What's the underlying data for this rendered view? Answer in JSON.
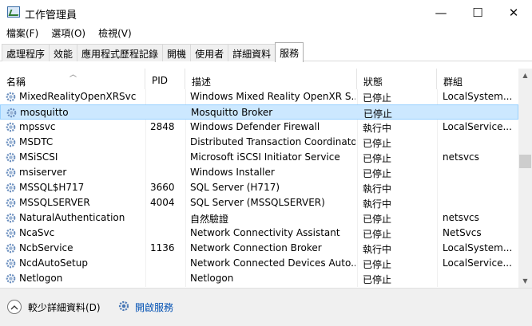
{
  "window": {
    "title": "工作管理員",
    "minimize_glyph": "—",
    "maximize_glyph": "☐",
    "close_glyph": "✕"
  },
  "menu": [
    "檔案(F)",
    "選項(O)",
    "檢視(V)"
  ],
  "tabs": [
    {
      "label": "處理程序",
      "active": false
    },
    {
      "label": "效能",
      "active": false
    },
    {
      "label": "應用程式歷程記錄",
      "active": false
    },
    {
      "label": "開機",
      "active": false
    },
    {
      "label": "使用者",
      "active": false
    },
    {
      "label": "詳細資料",
      "active": false
    },
    {
      "label": "服務",
      "active": true
    }
  ],
  "columns": {
    "name": "名稱",
    "pid": "PID",
    "description": "描述",
    "status": "狀態",
    "group": "群組"
  },
  "rows": [
    {
      "name": "MixedRealityOpenXRSvc",
      "pid": "",
      "description": "Windows Mixed Reality OpenXR S...",
      "status": "已停止",
      "group": "LocalSystem..."
    },
    {
      "name": "mosquitto",
      "pid": "",
      "description": "Mosquitto Broker",
      "status": "已停止",
      "group": ""
    },
    {
      "name": "mpssvc",
      "pid": "2848",
      "description": "Windows Defender Firewall",
      "status": "執行中",
      "group": "LocalService..."
    },
    {
      "name": "MSDTC",
      "pid": "",
      "description": "Distributed Transaction Coordinator",
      "status": "已停止",
      "group": ""
    },
    {
      "name": "MSiSCSI",
      "pid": "",
      "description": "Microsoft iSCSI Initiator Service",
      "status": "已停止",
      "group": "netsvcs"
    },
    {
      "name": "msiserver",
      "pid": "",
      "description": "Windows Installer",
      "status": "已停止",
      "group": ""
    },
    {
      "name": "MSSQL$H717",
      "pid": "3660",
      "description": "SQL Server (H717)",
      "status": "執行中",
      "group": ""
    },
    {
      "name": "MSSQLSERVER",
      "pid": "4004",
      "description": "SQL Server (MSSQLSERVER)",
      "status": "執行中",
      "group": ""
    },
    {
      "name": "NaturalAuthentication",
      "pid": "",
      "description": "自然驗證",
      "status": "已停止",
      "group": "netsvcs"
    },
    {
      "name": "NcaSvc",
      "pid": "",
      "description": "Network Connectivity Assistant",
      "status": "已停止",
      "group": "NetSvcs"
    },
    {
      "name": "NcbService",
      "pid": "1136",
      "description": "Network Connection Broker",
      "status": "執行中",
      "group": "LocalSystem..."
    },
    {
      "name": "NcdAutoSetup",
      "pid": "",
      "description": "Network Connected Devices Auto...",
      "status": "已停止",
      "group": "LocalService..."
    },
    {
      "name": "Netlogon",
      "pid": "",
      "description": "Netlogon",
      "status": "已停止",
      "group": ""
    }
  ],
  "selected_row": 1,
  "footer": {
    "fewer_details": "較少詳細資料(D)",
    "open_services": "開啟服務"
  },
  "colors": {
    "selection_bg": "#cce8ff",
    "selection_border": "#99d1ff",
    "link": "#0050b3"
  }
}
